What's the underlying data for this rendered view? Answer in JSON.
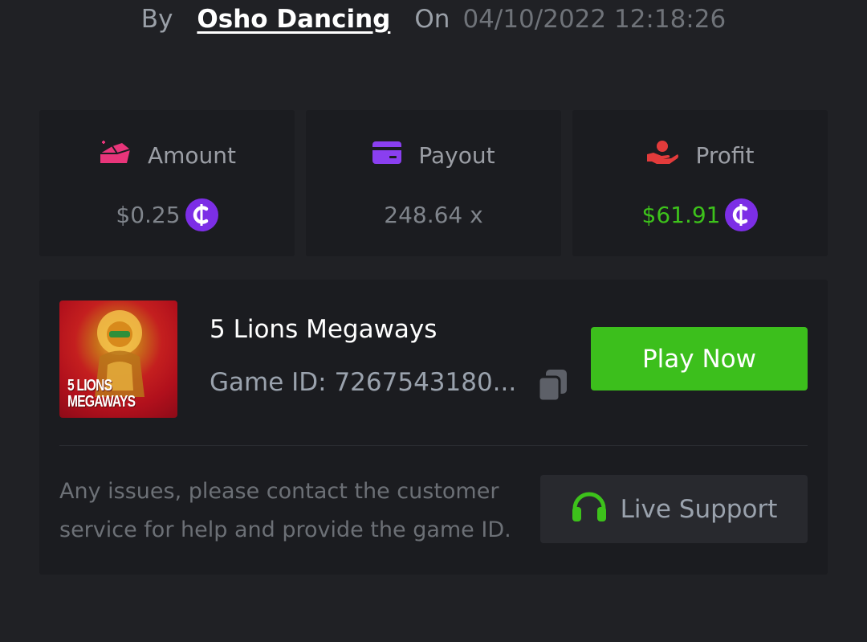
{
  "byline": {
    "by_label": "By",
    "author": "Osho Dancing",
    "on_label": "On",
    "datetime": "04/10/2022 12:18:26"
  },
  "stats": {
    "amount": {
      "label": "Amount",
      "value": "$0.25",
      "icon": "gem-icon",
      "icon_color": "#e8357a"
    },
    "payout": {
      "label": "Payout",
      "value": "248.64 x",
      "icon": "credit-card-icon",
      "icon_color": "#8a3ff0"
    },
    "profit": {
      "label": "Profit",
      "value": "$61.91",
      "icon": "hand-coin-icon",
      "icon_color": "#e33b3b",
      "value_color": "#3dc21b"
    },
    "coin_color": "#7c2ee6"
  },
  "game": {
    "thumbnail_text_line1": "5 LIONS",
    "thumbnail_text_line2": "MEGAWAYS",
    "title": "5 Lions Megaways",
    "game_id": "Game ID: 7267543180...",
    "play_label": "Play Now",
    "play_color": "#3cbf1c"
  },
  "support": {
    "help_text": "Any issues, please contact the customer service for help and provide the game ID.",
    "button_label": "Live Support",
    "icon": "headset-icon",
    "icon_color": "#3dc21b"
  }
}
